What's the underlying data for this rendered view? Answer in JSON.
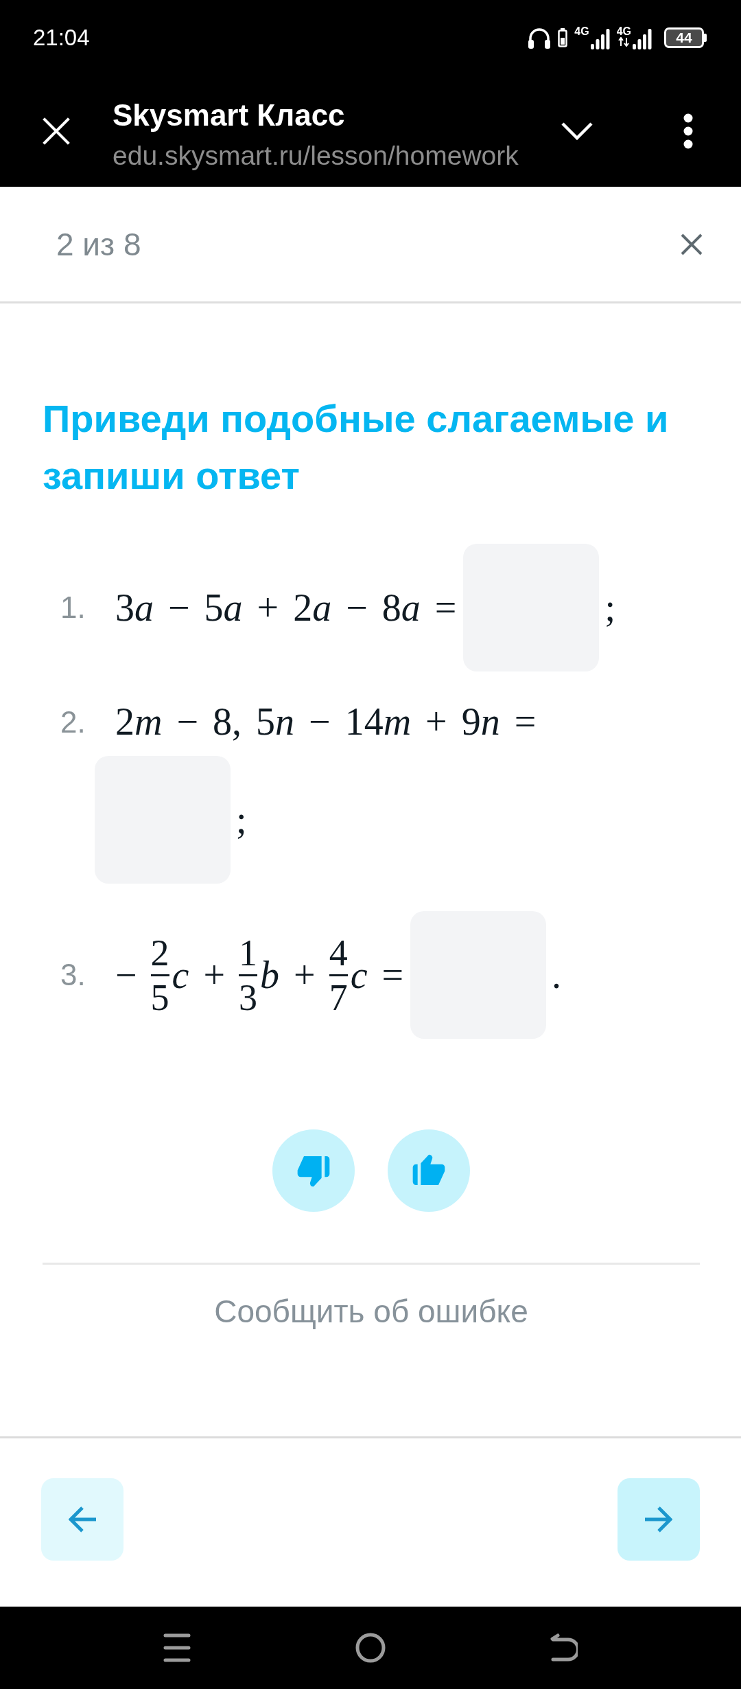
{
  "status_bar": {
    "time": "21:04",
    "networks": [
      {
        "label": "4G",
        "data_activity": false
      },
      {
        "label": "4G",
        "data_activity": true
      }
    ],
    "battery": "44"
  },
  "browser_bar": {
    "title": "Skysmart Класс",
    "url": "edu.skysmart.ru/lesson/homework"
  },
  "task_header": {
    "counter": "2 из 8"
  },
  "task": {
    "title": "Приведи подобные слагаемые и запиши ответ",
    "items": [
      {
        "number": "1.",
        "tokens": [
          {
            "kind": "text",
            "value": "3a − 5a + 2a − 8a ="
          },
          {
            "kind": "answer"
          },
          {
            "kind": "text",
            "value": ";"
          }
        ]
      },
      {
        "number": "2.",
        "tokens": [
          {
            "kind": "text",
            "value": "2m − 8, 5n − 14m + 9n ="
          },
          {
            "kind": "answer"
          },
          {
            "kind": "text",
            "value": ";"
          }
        ]
      },
      {
        "number": "3.",
        "tokens": [
          {
            "kind": "text",
            "value": "−"
          },
          {
            "kind": "fraction",
            "numerator": "2",
            "denominator": "5"
          },
          {
            "kind": "text",
            "value": "c +"
          },
          {
            "kind": "fraction",
            "numerator": "1",
            "denominator": "3"
          },
          {
            "kind": "text",
            "value": "b +"
          },
          {
            "kind": "fraction",
            "numerator": "4",
            "denominator": "7"
          },
          {
            "kind": "text",
            "value": "c ="
          },
          {
            "kind": "answer"
          },
          {
            "kind": "text",
            "value": "."
          }
        ]
      }
    ]
  },
  "report_link": "Сообщить об ошибке"
}
